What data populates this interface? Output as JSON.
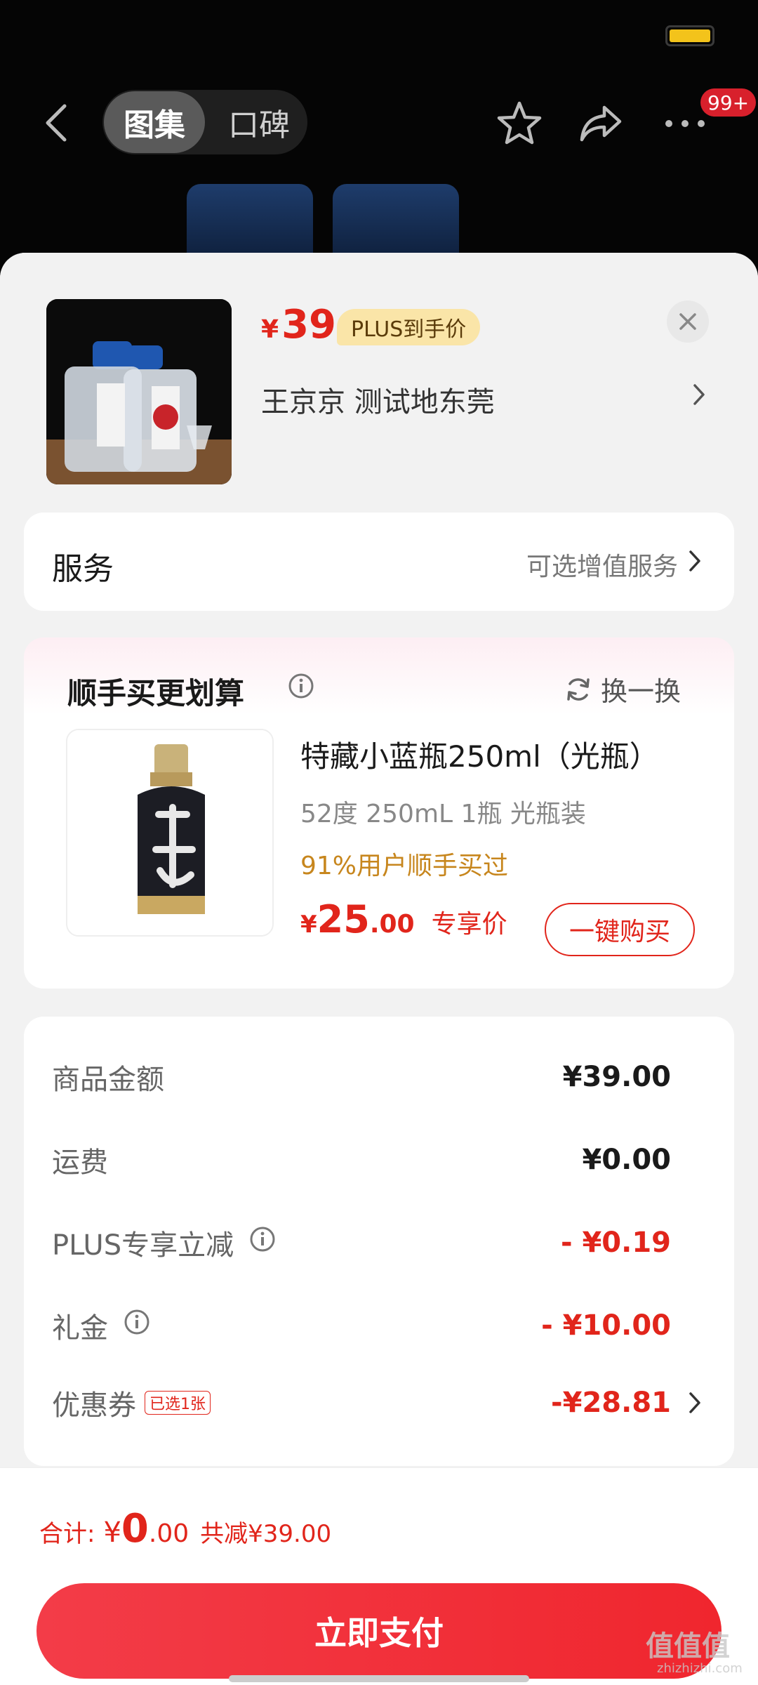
{
  "header": {
    "tabs": [
      {
        "label": "图集",
        "active": true
      },
      {
        "label": "口碑",
        "active": false
      }
    ],
    "badge": "99+"
  },
  "product": {
    "price_currency": "¥",
    "price": "39",
    "plus_tag": "PLUS到手价",
    "address": "王京京  测试地东莞"
  },
  "service": {
    "label": "服务",
    "value": "可选增值服务"
  },
  "upsell": {
    "title": "顺手买更划算",
    "swap_label": "换一换",
    "name": "特藏小蓝瓶250ml（光瓶）",
    "spec": "52度 250mL 1瓶 光瓶装",
    "stat": "91%用户顺手买过",
    "price_currency": "¥",
    "price_int": "25",
    "price_dec": ".00",
    "price_tag": "专享价",
    "buy_label": "一键购买"
  },
  "summary": {
    "rows": [
      {
        "label": "商品金额",
        "value": "¥39.00"
      },
      {
        "label": "运费",
        "value": "¥0.00"
      },
      {
        "label": "PLUS专享立减",
        "value": "- ¥0.19"
      },
      {
        "label": "礼金",
        "value": "- ¥10.00"
      },
      {
        "label": "优惠券",
        "value": "-¥28.81",
        "chip": "已选1张"
      }
    ]
  },
  "footer": {
    "total_label": "合计:",
    "total_currency": "¥",
    "total_int": "0",
    "total_dec": ".00",
    "saved": "共减¥39.00",
    "pay_label": "立即支付"
  },
  "watermark": {
    "main": "值值值",
    "sub": "zhizhizhi.com"
  },
  "colors": {
    "accent": "#e1251b",
    "plus_tag_bg": "#fae5a8",
    "battery": "#f3c31b",
    "pay_button": "#f0262e"
  }
}
